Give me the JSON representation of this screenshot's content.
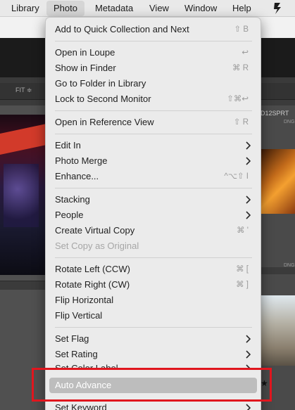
{
  "menubar": {
    "items": [
      "Library",
      "Photo",
      "Metadata",
      "View",
      "Window",
      "Help"
    ],
    "active": "Photo"
  },
  "background": {
    "fit_label": "FIT ≑",
    "thumb_id": "D12SPRT",
    "file_type_1": "DNG",
    "file_type_2": "DNG"
  },
  "menu": {
    "items": [
      {
        "label": "Add to Quick Collection and Next",
        "shortcut": "⇧ B"
      },
      {
        "label": "Open in Loupe",
        "shortcut": "↩"
      },
      {
        "label": "Show in Finder",
        "shortcut": "⌘ R"
      },
      {
        "label": "Go to Folder in Library",
        "shortcut": ""
      },
      {
        "label": "Lock to Second Monitor",
        "shortcut": "⇧⌘↩"
      },
      {
        "label": "Open in Reference View",
        "shortcut": "⇧ R"
      },
      {
        "label": "Edit In",
        "submenu": true
      },
      {
        "label": "Photo Merge",
        "submenu": true
      },
      {
        "label": "Enhance...",
        "shortcut": "^⌥⇧ I"
      },
      {
        "label": "Stacking",
        "submenu": true
      },
      {
        "label": "People",
        "submenu": true
      },
      {
        "label": "Create Virtual Copy",
        "shortcut": "⌘ '"
      },
      {
        "label": "Set Copy as Original",
        "disabled": true
      },
      {
        "label": "Rotate Left (CCW)",
        "shortcut": "⌘ ["
      },
      {
        "label": "Rotate Right (CW)",
        "shortcut": "⌘ ]"
      },
      {
        "label": "Flip Horizontal",
        "shortcut": ""
      },
      {
        "label": "Flip Vertical",
        "shortcut": ""
      },
      {
        "label": "Set Flag",
        "submenu": true
      },
      {
        "label": "Set Rating",
        "submenu": true
      },
      {
        "label": "Set Color Label",
        "submenu": true
      },
      {
        "label": "Auto Advance",
        "highlighted": true
      },
      {
        "label": "Set Keyword",
        "submenu": true
      }
    ]
  },
  "colors": {
    "highlight_box": "#e0161e",
    "menu_background": "#ebebeb",
    "selected_item": "#bdbdbd"
  }
}
